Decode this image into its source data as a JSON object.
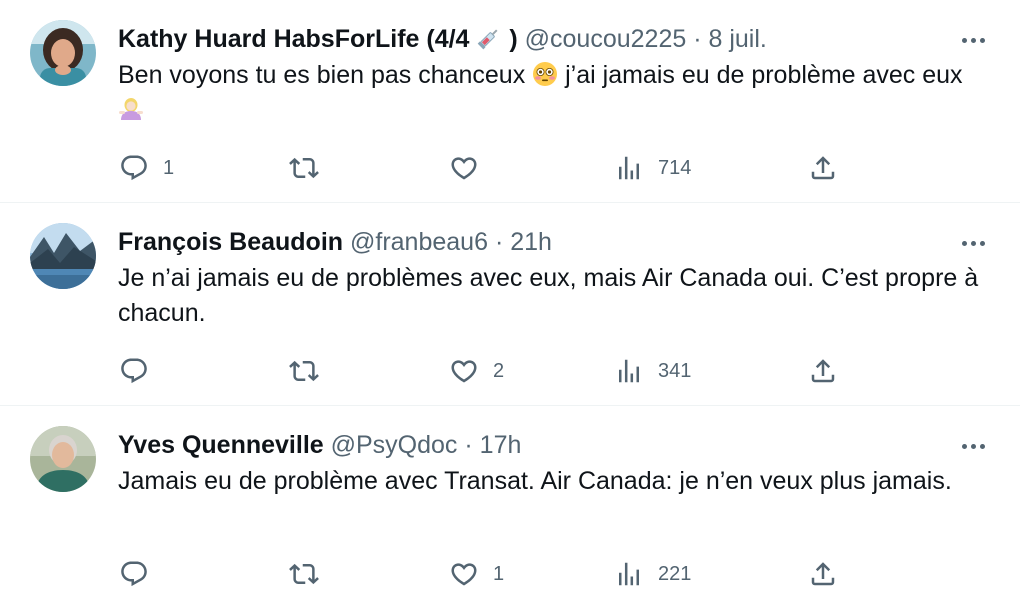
{
  "tweets": [
    {
      "author_name": "Kathy Huard HabsForLife (4/4",
      "author_suffix": ")",
      "handle": "@coucou2225",
      "separator": "·",
      "time": "8 juil.",
      "text_part1": "Ben voyons tu es bien pas chanceux",
      "text_part2": " j’ai jamais eu de problème avec eux",
      "emojis": [
        "syringe-emoji",
        "flushed-face-emoji",
        "shrug-emoji"
      ],
      "replies": "1",
      "retweets": "",
      "likes": "",
      "views": "714"
    },
    {
      "author_name": "François Beaudoin",
      "handle": "@franbeau6",
      "separator": "·",
      "time": "21h",
      "text": "Je n’ai jamais eu de problèmes avec eux, mais Air Canada oui. C’est propre à chacun.",
      "replies": "",
      "retweets": "",
      "likes": "2",
      "views": "341"
    },
    {
      "author_name": "Yves Quenneville",
      "handle": "@PsyQdoc",
      "separator": "·",
      "time": "17h",
      "text": "Jamais eu de problème avec Transat. Air Canada: je n’en veux plus jamais.",
      "replies": "",
      "retweets": "",
      "likes": "1",
      "views": "221"
    }
  ],
  "colors": {
    "text": "#0f1419",
    "secondary": "#536471",
    "divider": "#eff3f4"
  },
  "icons": [
    "reply-icon",
    "retweet-icon",
    "like-icon",
    "views-icon",
    "share-icon",
    "more-icon"
  ]
}
